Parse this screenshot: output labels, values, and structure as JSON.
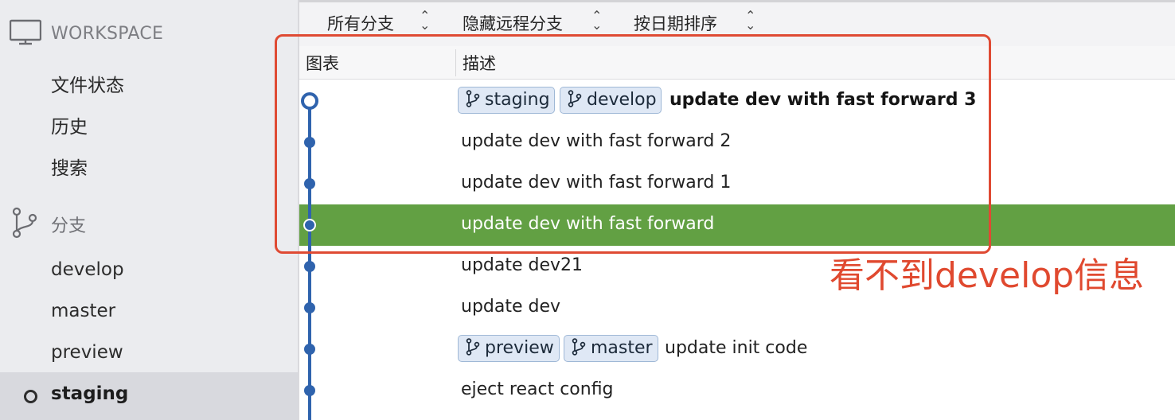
{
  "sidebar": {
    "workspace_title": "WORKSPACE",
    "workspace_items": [
      "文件状态",
      "历史",
      "搜索"
    ],
    "branches_title": "分支",
    "branches": [
      "develop",
      "master",
      "preview"
    ],
    "current_branch": "staging"
  },
  "toolbar": {
    "branch_filter": "所有分支",
    "remote_filter": "隐藏远程分支",
    "sort_order": "按日期排序"
  },
  "columns": {
    "graph": "图表",
    "description": "描述"
  },
  "commits": [
    {
      "tags": [
        "staging",
        "develop"
      ],
      "message": "update dev with fast forward 3",
      "bold": true
    },
    {
      "tags": [],
      "message": "update dev with fast forward 2"
    },
    {
      "tags": [],
      "message": "update dev with fast forward 1"
    },
    {
      "tags": [],
      "message": "update dev with fast forward",
      "selected": true
    },
    {
      "tags": [],
      "message": "update dev21"
    },
    {
      "tags": [],
      "message": "update dev"
    },
    {
      "tags": [
        "preview",
        "master"
      ],
      "message": "update init code"
    },
    {
      "tags": [],
      "message": "eject react config"
    }
  ],
  "annotation": "看不到develop信息",
  "colors": {
    "selected_row": "#62a043",
    "graph_line": "#2f63ad",
    "annotation": "#e0492f",
    "tag_bg": "#dfe8f5"
  }
}
